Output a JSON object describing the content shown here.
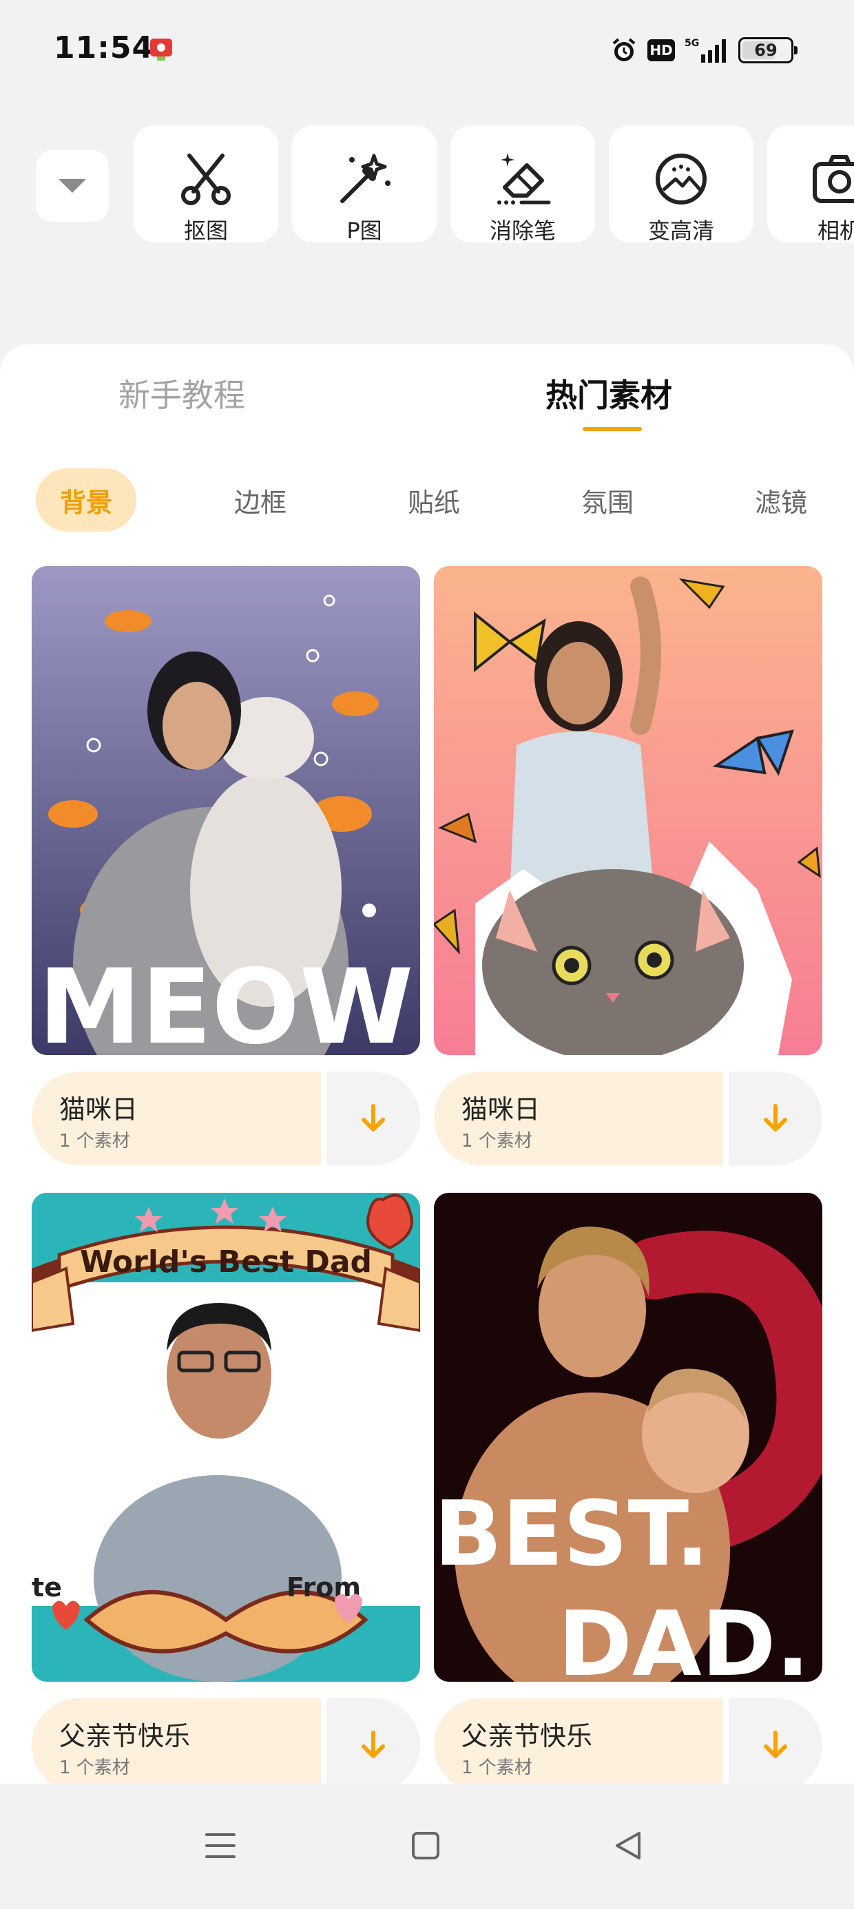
{
  "status_bar": {
    "time": "11:54",
    "network": "5G",
    "hd": "HD",
    "battery_percent": 69,
    "battery_text": "69"
  },
  "tools": [
    {
      "label": "抠图",
      "icon": "scissors-icon"
    },
    {
      "label": "P图",
      "icon": "magic-wand-icon"
    },
    {
      "label": "消除笔",
      "icon": "eraser-icon"
    },
    {
      "label": "变高清",
      "icon": "enhance-icon"
    },
    {
      "label": "相机",
      "icon": "camera-icon"
    }
  ],
  "main_tabs": [
    {
      "label": "新手教程",
      "active": false
    },
    {
      "label": "热门素材",
      "active": true
    }
  ],
  "categories": [
    {
      "label": "背景",
      "active": true
    },
    {
      "label": "边框",
      "active": false
    },
    {
      "label": "贴纸",
      "active": false
    },
    {
      "label": "氛围",
      "active": false
    },
    {
      "label": "滤镜",
      "active": false
    }
  ],
  "materials": [
    {
      "title": "猫咪日",
      "count": "1 个素材",
      "overlay_text": "MEOW"
    },
    {
      "title": "猫咪日",
      "count": "1 个素材",
      "overlay_text": ""
    },
    {
      "title": "父亲节快乐",
      "count": "1 个素材",
      "overlay_text": "World's Best Dad",
      "overlay_text_2": "te",
      "overlay_text_3": "From"
    },
    {
      "title": "父亲节快乐",
      "count": "1 个素材",
      "overlay_text": "BEST.",
      "overlay_text_2": "DAD."
    }
  ],
  "colors": {
    "accent": "#f5a300",
    "chip_active_bg": "#fde6bb",
    "info_bg": "#fdf0dc"
  }
}
